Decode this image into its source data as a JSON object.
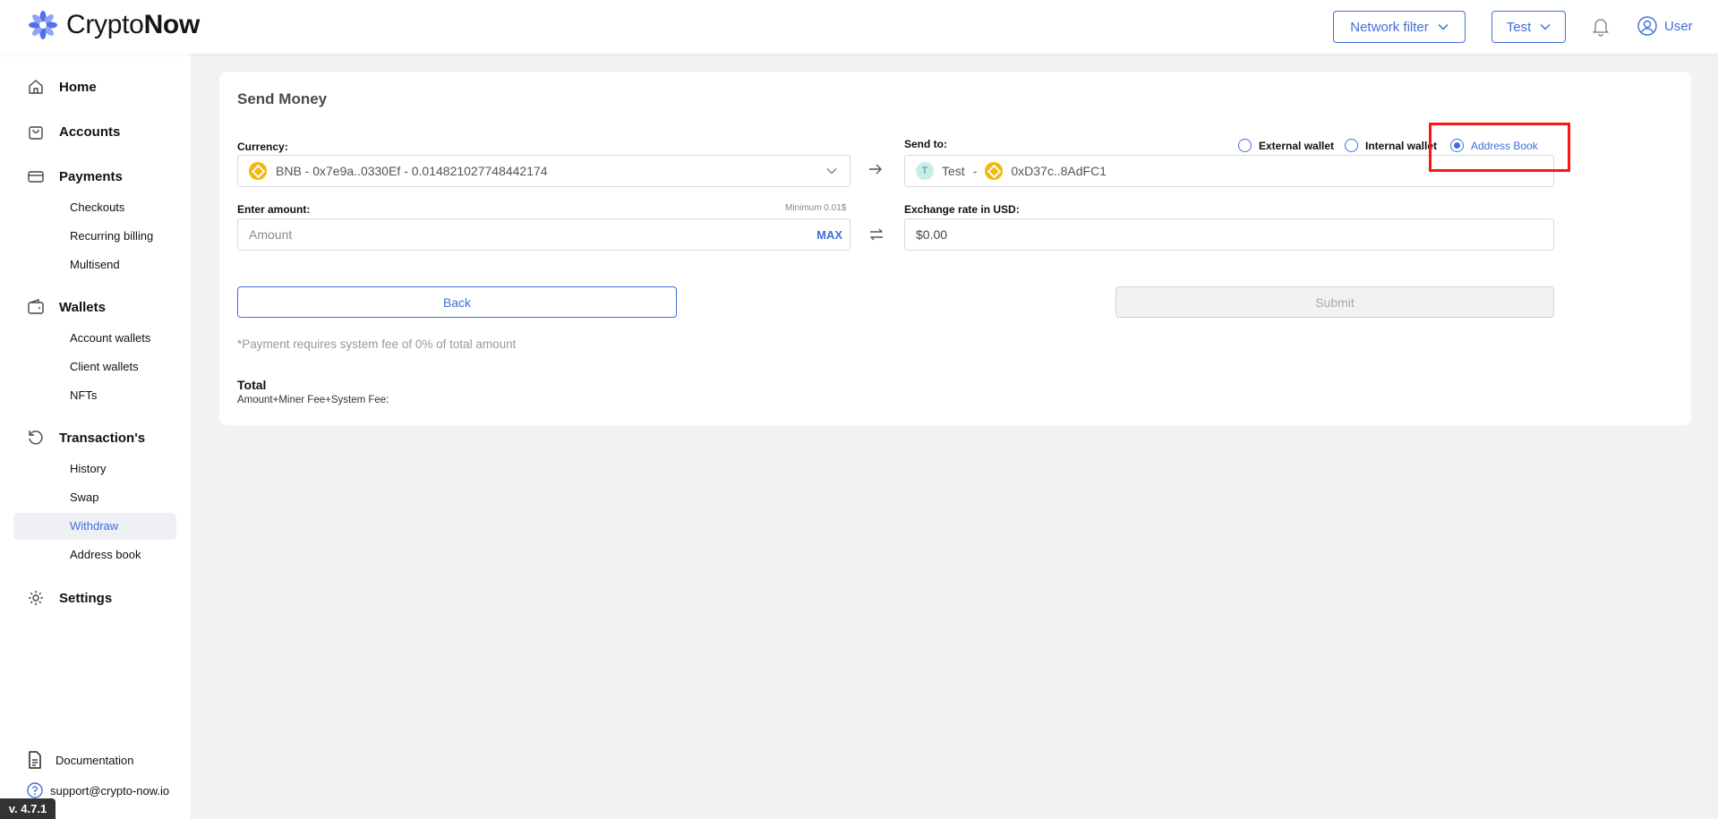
{
  "app": {
    "brand_light": "Crypto",
    "brand_bold": "Now",
    "version": "v. 4.7.1",
    "accent_color": "#3f6fd8"
  },
  "header": {
    "network_filter_label": "Network filter",
    "account_label": "Test",
    "user_label": "User"
  },
  "sidebar": {
    "home": "Home",
    "accounts": "Accounts",
    "payments": "Payments",
    "checkouts": "Checkouts",
    "recurring_billing": "Recurring billing",
    "multisend": "Multisend",
    "wallets": "Wallets",
    "account_wallets": "Account wallets",
    "client_wallets": "Client wallets",
    "nfts": "NFTs",
    "transactions": "Transaction's",
    "history": "History",
    "swap": "Swap",
    "withdraw": "Withdraw",
    "address_book": "Address book",
    "settings": "Settings",
    "documentation": "Documentation",
    "support_email": "support@crypto-now.io"
  },
  "send_money": {
    "title": "Send Money",
    "currency_label": "Currency:",
    "currency_value": "BNB - 0x7e9a..0330Ef - 0.014821027748442174",
    "send_to_label": "Send to:",
    "recipient_avatar": "T",
    "recipient_name": "Test",
    "recipient_separator": "-",
    "recipient_address": "0xD37c..8AdFC1",
    "radio_options": {
      "external": "External wallet",
      "internal": "Internal wallet",
      "address_book": "Address Book"
    },
    "selected_option": "Address Book",
    "amount_label": "Enter amount:",
    "minimum_note": "Minimum 0.01$",
    "amount_placeholder": "Amount",
    "max_label": "MAX",
    "exchange_label": "Exchange rate in USD:",
    "exchange_value": "$0.00",
    "back_label": "Back",
    "submit_label": "Submit",
    "fee_note": "*Payment requires system fee of 0% of total amount",
    "total_title": "Total",
    "total_subtitle": "Amount+Miner Fee+System Fee:"
  }
}
